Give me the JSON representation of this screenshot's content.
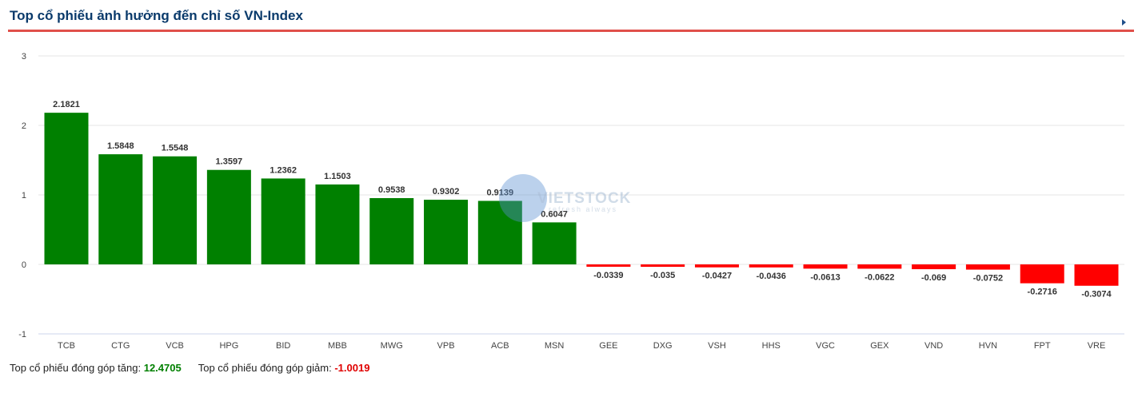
{
  "header": {
    "title": "Top cổ phiếu ảnh hưởng đến chỉ số VN-Index"
  },
  "watermark": {
    "brand": "VIETSTOCK",
    "tagline": "refresh always"
  },
  "footer": {
    "up_label": "Top cổ phiếu đóng góp tăng:",
    "up_value": "12.4705",
    "down_label": "Top cổ phiếu đóng góp giảm:",
    "down_value": "-1.0019"
  },
  "colors": {
    "positive": "#008000",
    "negative": "#ff0000",
    "title": "#0a3a6b",
    "rule": "#e0504a"
  },
  "chart_data": {
    "type": "bar",
    "title": "Top cổ phiếu ảnh hưởng đến chỉ số VN-Index",
    "xlabel": "",
    "ylabel": "",
    "ylim": [
      -1,
      3
    ],
    "yticks": [
      -1,
      0,
      1,
      2,
      3
    ],
    "grid": true,
    "categories": [
      "TCB",
      "CTG",
      "VCB",
      "HPG",
      "BID",
      "MBB",
      "MWG",
      "VPB",
      "ACB",
      "MSN",
      "GEE",
      "DXG",
      "VSH",
      "HHS",
      "VGC",
      "GEX",
      "VND",
      "HVN",
      "FPT",
      "VRE"
    ],
    "values": [
      2.1821,
      1.5848,
      1.5548,
      1.3597,
      1.2362,
      1.1503,
      0.9538,
      0.9302,
      0.9139,
      0.6047,
      -0.0339,
      -0.035,
      -0.0427,
      -0.0436,
      -0.0613,
      -0.0622,
      -0.069,
      -0.0752,
      -0.2716,
      -0.3074
    ],
    "labels": [
      "2.1821",
      "1.5848",
      "1.5548",
      "1.3597",
      "1.2362",
      "1.1503",
      "0.9538",
      "0.9302",
      "0.9139",
      "0.6047",
      "-0.0339",
      "-0.035",
      "-0.0427",
      "-0.0436",
      "-0.0613",
      "-0.0622",
      "-0.069",
      "-0.0752",
      "-0.2716",
      "-0.3074"
    ]
  }
}
